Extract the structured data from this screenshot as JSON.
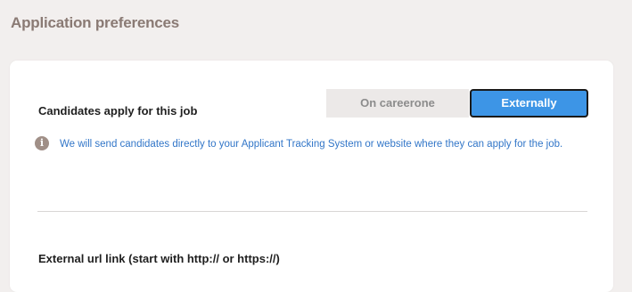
{
  "section": {
    "title": "Application preferences"
  },
  "apply": {
    "question": "Candidates apply for this job",
    "options": [
      {
        "label": "On careerone",
        "selected": false
      },
      {
        "label": "Externally",
        "selected": true
      }
    ],
    "info_text": "We will send candidates directly to your Applicant Tracking System or website where they can apply for the job.",
    "info_icon": "info-icon"
  },
  "external_url": {
    "label": "External url link (start with http:// or https://)"
  },
  "colors": {
    "accent": "#3d95e6",
    "info_text": "#3276c8",
    "title": "#8a7a74",
    "background": "#f2efee"
  }
}
